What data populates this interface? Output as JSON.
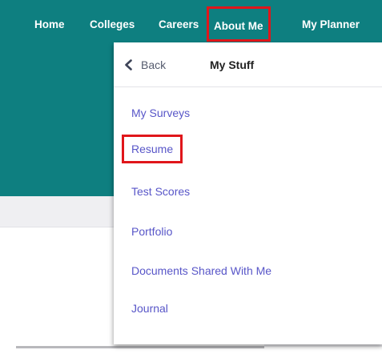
{
  "nav": {
    "items": [
      {
        "label": "Home"
      },
      {
        "label": "Colleges"
      },
      {
        "label": "Careers"
      },
      {
        "label": "About Me"
      },
      {
        "label": "My Planner"
      }
    ]
  },
  "dropdown": {
    "back_label": "Back",
    "title": "My Stuff",
    "items": [
      {
        "label": "My Surveys"
      },
      {
        "label": "Resume"
      },
      {
        "label": "Test Scores"
      },
      {
        "label": "Portfolio"
      },
      {
        "label": "Documents Shared With Me"
      },
      {
        "label": "Journal"
      }
    ]
  },
  "colors": {
    "nav_background": "#0e7f80",
    "highlight_border": "#e0161b",
    "link": "#5856c8"
  }
}
